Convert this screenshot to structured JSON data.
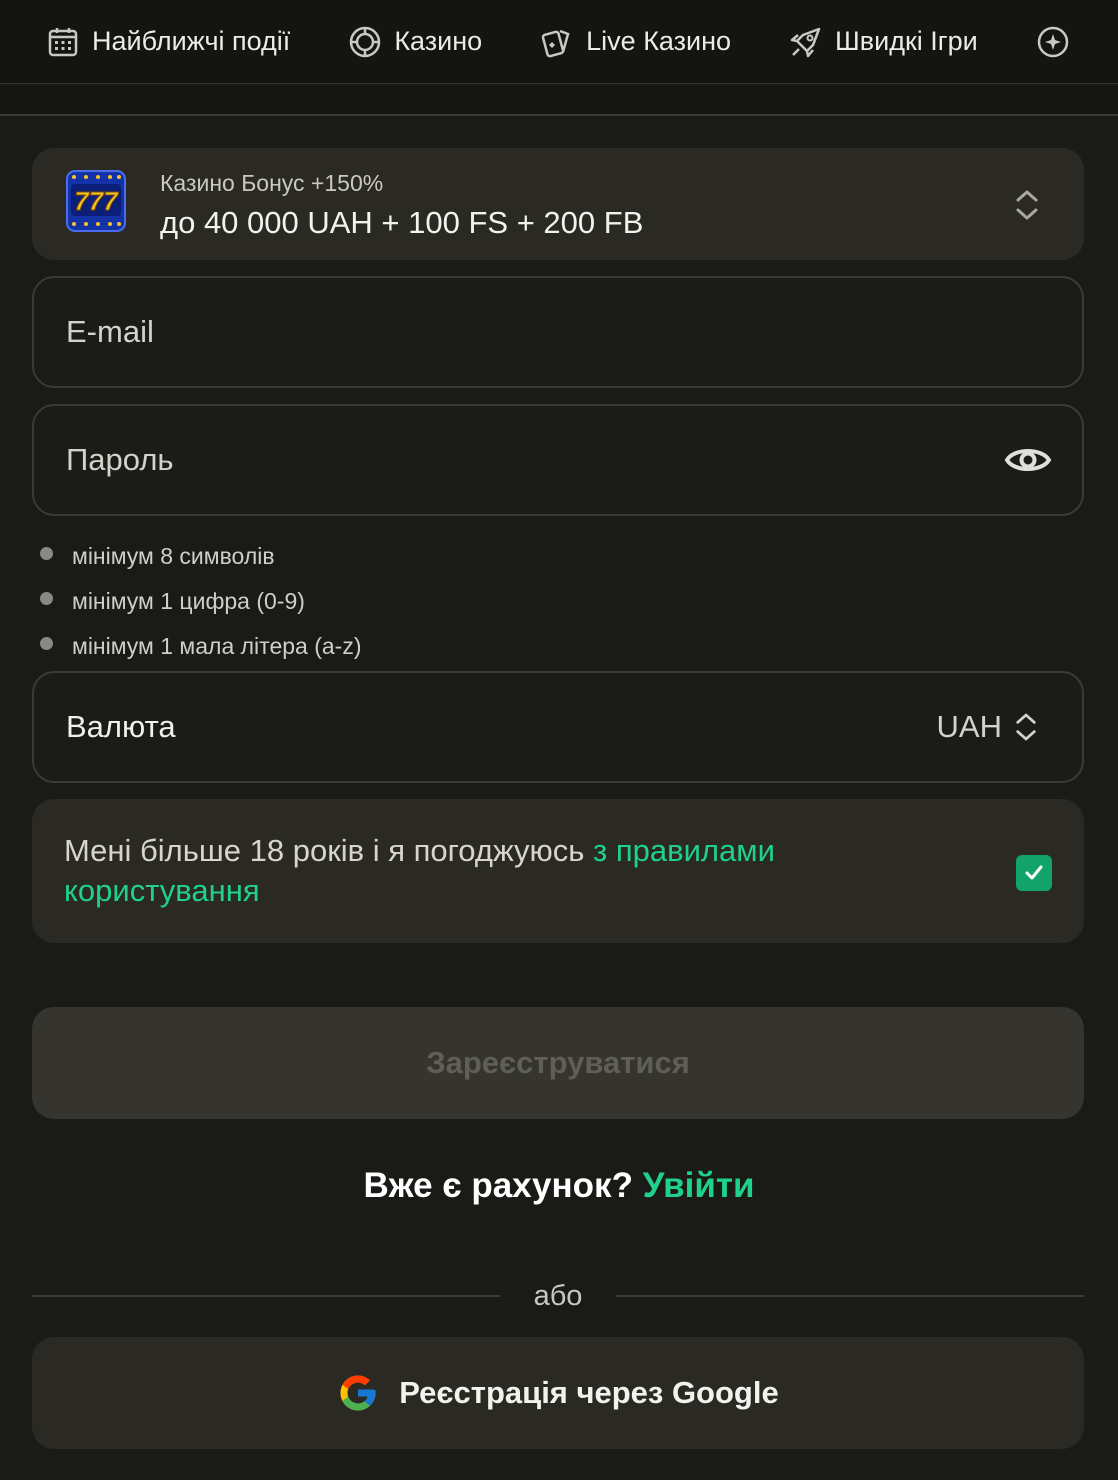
{
  "nav": {
    "items": [
      {
        "label": "Найближчі події",
        "icon": "calendar-icon"
      },
      {
        "label": "Казино",
        "icon": "casino-chip-icon"
      },
      {
        "label": "Live Казино",
        "icon": "cards-icon"
      },
      {
        "label": "Швидкі Ігри",
        "icon": "rocket-icon"
      }
    ]
  },
  "bonus": {
    "subtitle": "Казино Бонус +150%",
    "title": "до 40 000 UAH + 100 FS + 200 FB",
    "logo_text": "777"
  },
  "form": {
    "email_placeholder": "E-mail",
    "password_placeholder": "Пароль",
    "rules": [
      "мінімум 8 символів",
      "мінімум 1 цифра (0-9)",
      "мінімум 1 мала літера (a-z)"
    ],
    "currency_label": "Валюта",
    "currency_value": "UAH",
    "agree_text": "Мені більше 18 років і я погоджуюсь ",
    "agree_link": "з правилами користування",
    "agree_checked": true,
    "register_label": "Зареєструватися"
  },
  "login": {
    "question": "Вже є рахунок? ",
    "link": "Увійти"
  },
  "divider": "або",
  "google": {
    "label": "Реєстрація через Google"
  },
  "colors": {
    "accent": "#1fd18a",
    "background": "#1a1a17",
    "panel": "#2a2923"
  }
}
